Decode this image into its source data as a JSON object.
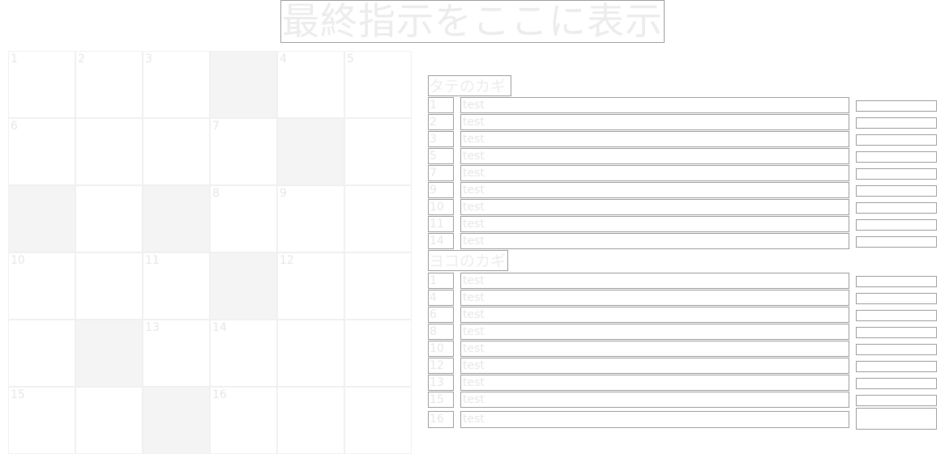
{
  "title": "最終指示をここに表示",
  "grid": {
    "rows": 6,
    "cols": 6,
    "cells": [
      [
        {
          "n": "1",
          "b": false
        },
        {
          "n": "2",
          "b": false
        },
        {
          "n": "3",
          "b": false
        },
        {
          "n": "",
          "b": true
        },
        {
          "n": "4",
          "b": false
        },
        {
          "n": "5",
          "b": false
        }
      ],
      [
        {
          "n": "6",
          "b": false
        },
        {
          "n": "",
          "b": false
        },
        {
          "n": "",
          "b": false
        },
        {
          "n": "7",
          "b": false
        },
        {
          "n": "",
          "b": true
        },
        {
          "n": "",
          "b": false
        }
      ],
      [
        {
          "n": "",
          "b": true
        },
        {
          "n": "",
          "b": false
        },
        {
          "n": "",
          "b": true
        },
        {
          "n": "8",
          "b": false
        },
        {
          "n": "9",
          "b": false
        },
        {
          "n": "",
          "b": false
        }
      ],
      [
        {
          "n": "10",
          "b": false
        },
        {
          "n": "",
          "b": false
        },
        {
          "n": "11",
          "b": false
        },
        {
          "n": "",
          "b": true
        },
        {
          "n": "12",
          "b": false
        },
        {
          "n": "",
          "b": false
        }
      ],
      [
        {
          "n": "",
          "b": false
        },
        {
          "n": "",
          "b": true
        },
        {
          "n": "13",
          "b": false
        },
        {
          "n": "14",
          "b": false
        },
        {
          "n": "",
          "b": false
        },
        {
          "n": "",
          "b": false
        }
      ],
      [
        {
          "n": "15",
          "b": false
        },
        {
          "n": "",
          "b": false
        },
        {
          "n": "",
          "b": true
        },
        {
          "n": "16",
          "b": false
        },
        {
          "n": "",
          "b": false
        },
        {
          "n": "",
          "b": false
        }
      ]
    ]
  },
  "down": {
    "header": "タテのカギ",
    "clues": [
      {
        "num": "1",
        "text": "test"
      },
      {
        "num": "2",
        "text": "test"
      },
      {
        "num": "3",
        "text": "test"
      },
      {
        "num": "5",
        "text": "test"
      },
      {
        "num": "7",
        "text": "test"
      },
      {
        "num": "9",
        "text": "test"
      },
      {
        "num": "10",
        "text": "test"
      },
      {
        "num": "11",
        "text": "test"
      },
      {
        "num": "14",
        "text": "test"
      }
    ]
  },
  "across": {
    "header": "ヨコのカギ",
    "clues": [
      {
        "num": "1",
        "text": "test"
      },
      {
        "num": "4",
        "text": "test"
      },
      {
        "num": "6",
        "text": "test"
      },
      {
        "num": "8",
        "text": "test"
      },
      {
        "num": "10",
        "text": "test"
      },
      {
        "num": "12",
        "text": "test"
      },
      {
        "num": "13",
        "text": "test"
      },
      {
        "num": "15",
        "text": "test"
      },
      {
        "num": "16",
        "text": "test"
      }
    ]
  }
}
